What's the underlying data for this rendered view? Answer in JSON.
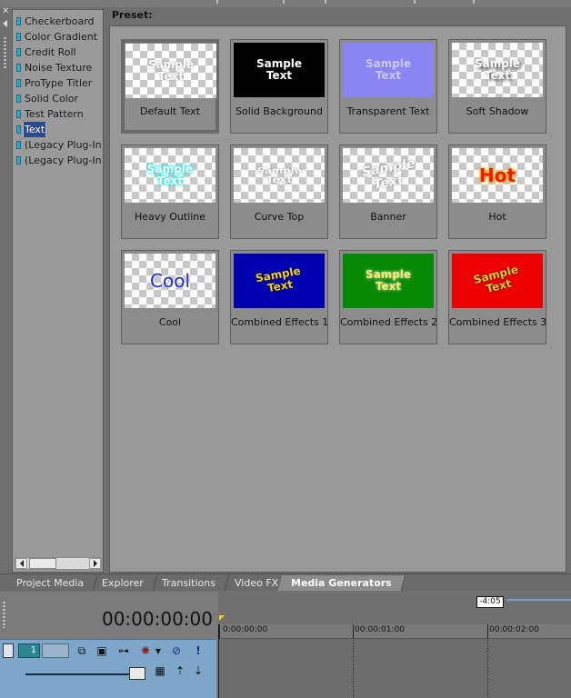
{
  "tree": {
    "items": [
      {
        "label": "Checkerboard",
        "selected": false
      },
      {
        "label": "Color Gradient",
        "selected": false
      },
      {
        "label": "Credit Roll",
        "selected": false
      },
      {
        "label": "Noise Texture",
        "selected": false
      },
      {
        "label": "ProType Titler",
        "selected": false
      },
      {
        "label": "Solid Color",
        "selected": false
      },
      {
        "label": "Test Pattern",
        "selected": false
      },
      {
        "label": "Text",
        "selected": true
      },
      {
        "label": "(Legacy Plug-In) T",
        "selected": false
      },
      {
        "label": "(Legacy Plug-In) W",
        "selected": false
      }
    ]
  },
  "preset": {
    "label": "Preset:",
    "tiles": [
      {
        "caption": "Default Text",
        "preview": "Sample\nText",
        "selected": true
      },
      {
        "caption": "Solid Background",
        "preview": "Sample\nText",
        "selected": false
      },
      {
        "caption": "Transparent Text",
        "preview": "Sample\nText",
        "selected": false
      },
      {
        "caption": "Soft Shadow",
        "preview": "Sample\nText",
        "selected": false
      },
      {
        "caption": "Heavy Outline",
        "preview": "Sample\nText",
        "selected": false
      },
      {
        "caption": "Curve Top",
        "preview": "Sample\nText",
        "selected": false
      },
      {
        "caption": "Banner",
        "preview": "Sample\nText",
        "selected": false
      },
      {
        "caption": "Hot",
        "preview": "Hot",
        "selected": false
      },
      {
        "caption": "Cool",
        "preview": "Cool",
        "selected": false
      },
      {
        "caption": "Combined Effects 1",
        "preview": "Sample\nText",
        "selected": false
      },
      {
        "caption": "Combined Effects 2",
        "preview": "Sample\nText",
        "selected": false
      },
      {
        "caption": "Combined Effects 3",
        "preview": "Sample\nText",
        "selected": false
      }
    ]
  },
  "tabs": [
    {
      "label": "Project Media",
      "active": false
    },
    {
      "label": "Explorer",
      "active": false
    },
    {
      "label": "Transitions",
      "active": false
    },
    {
      "label": "Video FX",
      "active": false
    },
    {
      "label": "Media Generators",
      "active": true
    }
  ],
  "timeline": {
    "timecode": "00:00:00:00",
    "length_badge": "-4:05",
    "ruler_labels": [
      "0:00:00:00",
      "00:00:01:00",
      "00:00:02:00"
    ],
    "track_number": "1"
  },
  "colors": {
    "selection": "#2d4a8f",
    "track_header": "#7ea6c9",
    "panel_bg": "#999999"
  },
  "icons": {
    "close": "close-icon",
    "collapse": "chevron-left-icon",
    "track_tools": [
      "minimize-icon",
      "composite-mode-icon",
      "mask-icon",
      "motion-icon",
      "fx-icon",
      "mute-icon",
      "solo-icon"
    ]
  }
}
